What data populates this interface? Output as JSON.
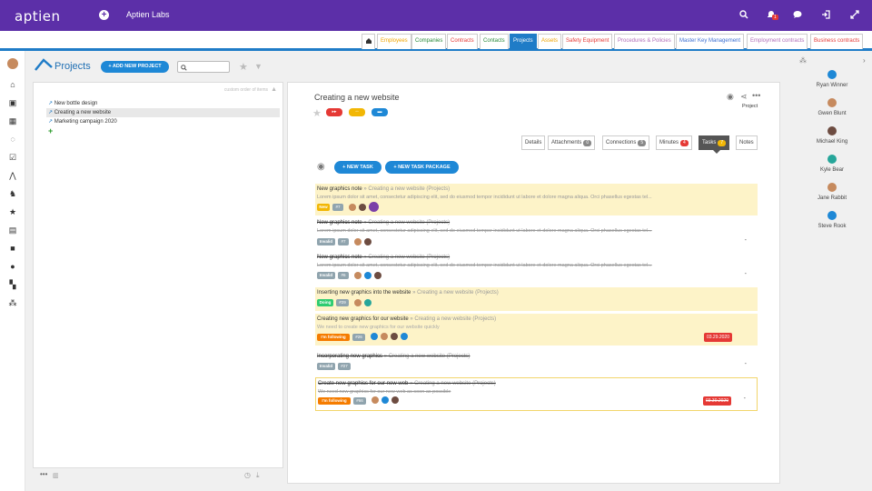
{
  "app": {
    "logo": "aptien",
    "company": "Aptien Labs",
    "notif_count": "1"
  },
  "tabs": [
    {
      "label": "Employees",
      "color": "#f0a500"
    },
    {
      "label": "Companies",
      "color": "#2a8a3a"
    },
    {
      "label": "Contracts",
      "color": "#e53935"
    },
    {
      "label": "Contacts",
      "color": "#2a8a3a"
    },
    {
      "label": "Projects",
      "color": "#ffffff"
    },
    {
      "label": "Assets",
      "color": "#f0a500"
    },
    {
      "label": "Safety Equipment",
      "color": "#e53935"
    },
    {
      "label": "Procedures & Policies",
      "color": "#b06fb8"
    },
    {
      "label": "Master Key Management",
      "color": "#3b6fd1"
    },
    {
      "label": "Employment contracts",
      "color": "#b06fb8"
    },
    {
      "label": "Business contracts",
      "color": "#e53935"
    }
  ],
  "projects": {
    "title": "Projects",
    "add_button": "+ ADD NEW PROJECT",
    "order_label": "custom order of items",
    "tree": [
      "New bottle design",
      "Creating a new website",
      "Marketing campaign 2020"
    ]
  },
  "detail": {
    "title": "Creating a new website",
    "type_label": "Project",
    "subtabs": [
      {
        "label": "Details",
        "count": ""
      },
      {
        "label": "Attachments",
        "count": "0"
      },
      {
        "label": "Connections",
        "count": "5"
      },
      {
        "label": "Minutes",
        "count": "4"
      },
      {
        "label": "Tasks",
        "count": "7"
      },
      {
        "label": "Notes",
        "count": ""
      }
    ],
    "new_task": "+ NEW TASK",
    "new_package": "+ NEW TASK PACKAGE"
  },
  "tasks": [
    {
      "title": "New graphics note",
      "crumb": "» Creating a new website (Projects)",
      "desc": "Lorem ipsum dolor sit amet, consectetur adipiscing elit, sed do eiusmod tempor incididunt ut labore et dolore magna aliqua. Orci phasellus egestas tel...",
      "status": "New",
      "num": "#7",
      "date": "",
      "done": false
    },
    {
      "title": "New graphics note",
      "crumb": "» Creating a new website (Projects)",
      "desc": "Lorem ipsum dolor sit amet, consectetur adipiscing elit, sed do eiusmod tempor incididunt ut labore et dolore magna aliqua. Orci phasellus egestas tel...",
      "status": "Invalid",
      "num": "#7",
      "date": "",
      "done": true
    },
    {
      "title": "New graphics note",
      "crumb": "» Creating a new website (Projects)",
      "desc": "Lorem ipsum dolor sit amet, consectetur adipiscing elit, sed do eiusmod tempor incididunt ut labore et dolore magna aliqua. Orci phasellus egestas tel...",
      "status": "Invalid",
      "num": "#6",
      "date": "",
      "done": true
    },
    {
      "title": "Inserting new graphics into the website",
      "crumb": "» Creating a new website (Projects)",
      "desc": "",
      "status": "Doing",
      "num": "#29",
      "date": "",
      "done": false
    },
    {
      "title": "Creating new graphics for our website",
      "crumb": "» Creating a new website (Projects)",
      "desc": "We need to create new graphics for our website quickly",
      "status": "I'm following",
      "num": "#26",
      "date": "03.29.2020",
      "done": false
    },
    {
      "title": "Incorporating new graphics",
      "crumb": "» Creating a new website (Projects)",
      "desc": "",
      "status": "Invalid",
      "num": "#27",
      "date": "",
      "done": true
    },
    {
      "title": "Create new graphics for our new web",
      "crumb": "» Creating a new website (Projects)",
      "desc": "We need new graphics for our new web as soon as possible",
      "status": "I'm following",
      "num": "#66",
      "date": "03.30.2020",
      "done": true
    }
  ],
  "people": [
    "Ryan Winner",
    "Gwen Blunt",
    "Michael King",
    "Kyle Bear",
    "Jane Rabbit",
    "Steve Rook"
  ]
}
